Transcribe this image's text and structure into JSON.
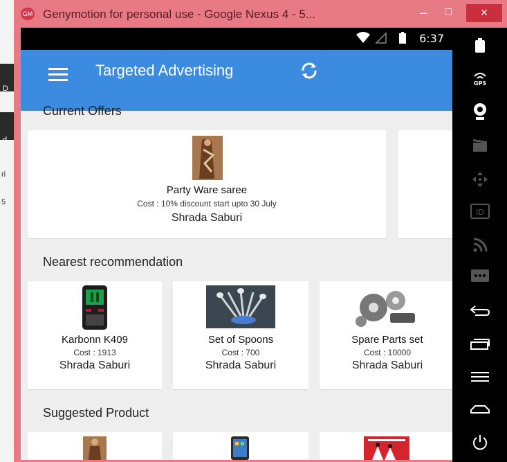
{
  "window": {
    "title": "Genymotion for personal use - Google Nexus 4 - 5...",
    "logo_text": "GM",
    "minimize": "–",
    "maximize": "□",
    "close": "×"
  },
  "left_strip": {
    "labels": [
      "D",
      "d",
      "ri",
      "5"
    ]
  },
  "status_bar": {
    "time": "6:37"
  },
  "app_bar": {
    "title": "Targeted Advertising"
  },
  "sections": {
    "current_offers": {
      "title": "Current Offers",
      "items": [
        {
          "name": "Party Ware saree",
          "cost": "Cost : 10% discount start upto 30 July",
          "seller": "Shrada Saburi"
        }
      ]
    },
    "nearest": {
      "title": "Nearest recommendation",
      "items": [
        {
          "name": "Karbonn K409",
          "cost": "Cost : 1913",
          "seller": "Shrada Saburi"
        },
        {
          "name": "Set of Spoons",
          "cost": "Cost : 700",
          "seller": "Shrada Saburi"
        },
        {
          "name": "Spare Parts set",
          "cost": "Cost : 10000",
          "seller": "Shrada Saburi"
        }
      ]
    },
    "suggested": {
      "title": "Suggested Product"
    }
  },
  "sidebar_icons": [
    "battery-icon",
    "gps-icon",
    "webcam-icon",
    "clapper-icon",
    "dpad-icon",
    "id-icon",
    "signal-icon",
    "more-icon",
    "back-icon",
    "recent-apps-icon",
    "menu-icon",
    "home-icon",
    "power-icon"
  ]
}
